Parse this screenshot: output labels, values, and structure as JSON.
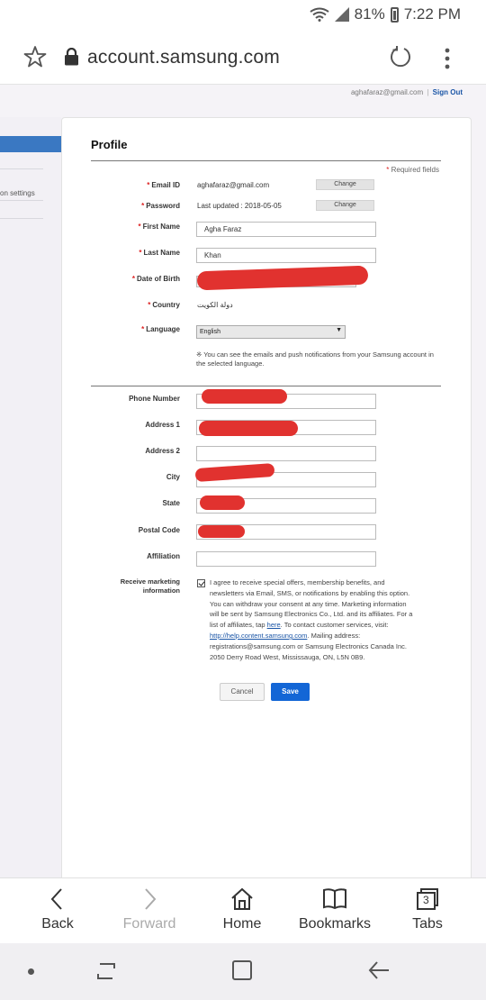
{
  "status_bar": {
    "battery": "81%",
    "time": "7:22 PM"
  },
  "browser": {
    "url": "account.samsung.com"
  },
  "page": {
    "user_email": "aghafaraz@gmail.com",
    "separator": "|",
    "sign_out": "Sign Out",
    "nav_item": "on settings",
    "title": "Profile",
    "required_note": "Required fields",
    "asterisk": "*",
    "fields": {
      "email_label": "Email ID",
      "email_value": "aghafaraz@gmail.com",
      "email_change": "Change",
      "password_label": "Password",
      "password_value": "Last updated : 2018-05-05",
      "password_change": "Change",
      "first_name_label": "First Name",
      "first_name_value": "Agha Faraz",
      "last_name_label": "Last Name",
      "last_name_value": "Khan",
      "dob_label": "Date of Birth",
      "country_label": "Country",
      "country_value": "دولة الكويت",
      "language_label": "Language",
      "language_value": "English",
      "language_note": "※ You can see the emails and push notifications from your Samsung account in the selected language.",
      "phone_label": "Phone Number",
      "address1_label": "Address 1",
      "address2_label": "Address 2",
      "city_label": "City",
      "state_label": "State",
      "postal_label": "Postal Code",
      "affiliation_label": "Affiliation"
    },
    "marketing": {
      "label": "Receive marketing information",
      "text_before_here": "I agree to receive special offers, membership benefits, and newsletters via Email, SMS, or notifications by enabling this option. You can withdraw your consent at any time. Marketing information will be sent by Samsung Electronics Co., Ltd. and its affiliates. For a list of affiliates, tap",
      "here_link": "here",
      "text_mid": ". To contact customer services, visit:",
      "help_link": "http://help.content.samsung.com",
      "text_after": ". Mailing address: registrations@samsung.com or Samsung Electronics Canada Inc. 2050 Derry Road West, Mississauga, ON, L5N 0B9."
    },
    "cancel_label": "Cancel",
    "save_label": "Save"
  },
  "toolbar": {
    "back": "Back",
    "forward": "Forward",
    "home": "Home",
    "bookmarks": "Bookmarks",
    "tabs": "Tabs",
    "tab_count": "3"
  },
  "colors": {
    "accent": "#1366d6",
    "redaction": "#e1322f",
    "required": "#dd2222"
  }
}
